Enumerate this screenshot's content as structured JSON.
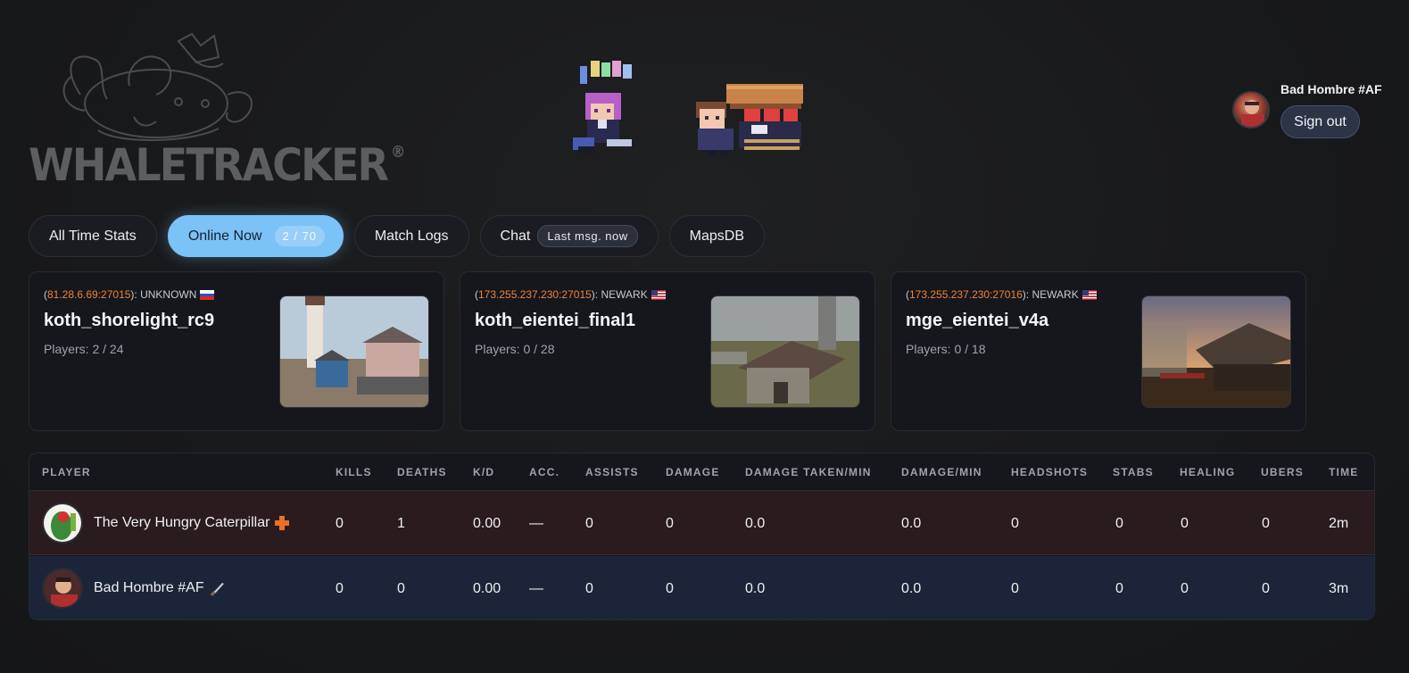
{
  "brand": {
    "logo_text": "WHALETRACKER",
    "registered": "®"
  },
  "user": {
    "name": "Bad Hombre #AF",
    "signout_label": "Sign out"
  },
  "tabs": [
    {
      "label": "All Time Stats"
    },
    {
      "label": "Online Now",
      "badge": "2 / 70"
    },
    {
      "label": "Match Logs"
    },
    {
      "label": "Chat",
      "badge": "Last msg. now"
    },
    {
      "label": "MapsDB"
    }
  ],
  "servers": [
    {
      "ip": "81.28.6.69:27015",
      "location": "UNKNOWN",
      "flag": "ru-flag",
      "map": "koth_shorelight_rc9",
      "players": "Players: 2 / 24"
    },
    {
      "ip": "173.255.237.230:27015",
      "location": "NEWARK",
      "flag": "us-flag",
      "map": "koth_eientei_final1",
      "players": "Players: 0 / 28"
    },
    {
      "ip": "173.255.237.230:27016",
      "location": "NEWARK",
      "flag": "us-flag",
      "map": "mge_eientei_v4a",
      "players": "Players: 0 / 18"
    }
  ],
  "table": {
    "headers": [
      "PLAYER",
      "KILLS",
      "DEATHS",
      "K/D",
      "ACC.",
      "ASSISTS",
      "DAMAGE",
      "DAMAGE TAKEN/MIN",
      "DAMAGE/MIN",
      "HEADSHOTS",
      "STABS",
      "HEALING",
      "UBERS",
      "TIME"
    ],
    "rows": [
      {
        "team": "red",
        "name": "The Very Hungry Caterpillar",
        "class_icon": "medic-cross-icon",
        "kills": "0",
        "deaths": "1",
        "kd": "0.00",
        "acc": "—",
        "assists": "0",
        "damage": "0",
        "dtm": "0.0",
        "dpm": "0.0",
        "headshots": "0",
        "stabs": "0",
        "healing": "0",
        "ubers": "0",
        "time": "2m"
      },
      {
        "team": "blue",
        "name": "Bad Hombre #AF",
        "class_icon": "knife-icon",
        "kills": "0",
        "deaths": "0",
        "kd": "0.00",
        "acc": "—",
        "assists": "0",
        "damage": "0",
        "dtm": "0.0",
        "dpm": "0.0",
        "headshots": "0",
        "stabs": "0",
        "healing": "0",
        "ubers": "0",
        "time": "3m"
      }
    ]
  },
  "colors": {
    "accent": "#7bc2f7",
    "ip": "#ee8436",
    "red_team": "#2a1b1e",
    "blue_team": "#1b2438"
  }
}
